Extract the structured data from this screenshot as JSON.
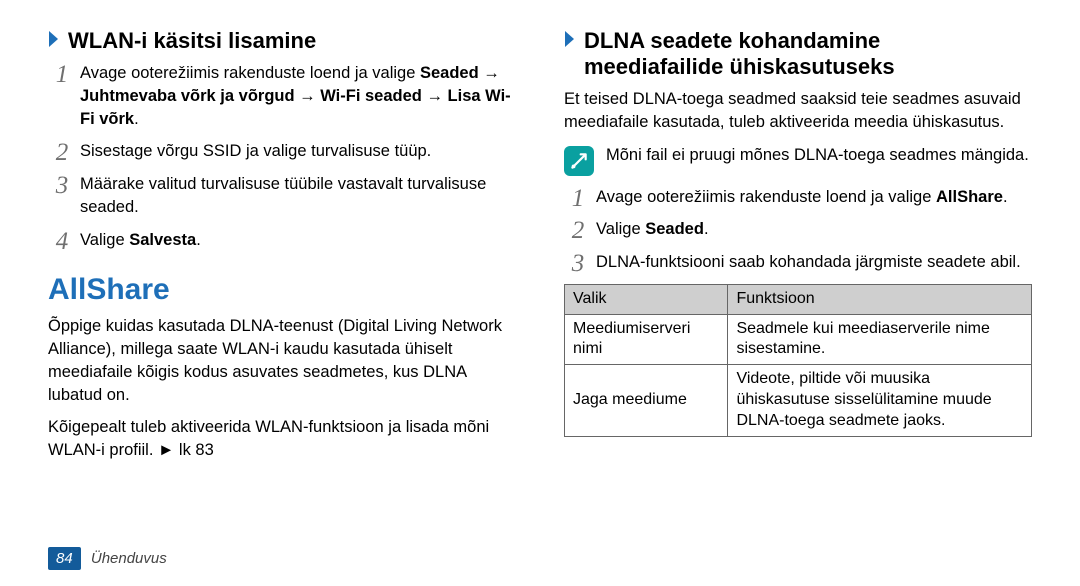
{
  "left": {
    "heading": "WLAN-i käsitsi lisamine",
    "step1_a": "Avage ooterežiimis rakenduste loend ja valige ",
    "step1_b": "Seaded",
    "step1_c": " → ",
    "step1_d": "Juhtmevaba võrk ja võrgud",
    "step1_e": " → ",
    "step1_f": "Wi-Fi seaded",
    "step1_g": " → ",
    "step1_h": "Lisa Wi-Fi võrk",
    "step1_i": ".",
    "step2": "Sisestage võrgu SSID ja valige turvalisuse tüüp.",
    "step3": "Määrake valitud turvalisuse tüübile vastavalt turvalisuse seaded.",
    "step4_a": "Valige ",
    "step4_b": "Salvesta",
    "step4_c": ".",
    "section_title": "AllShare",
    "para1": "Õppige kuidas kasutada DLNA-teenust (Digital Living Network Alliance), millega saate WLAN-i kaudu kasutada ühiselt meediafaile kõigis kodus asuvates seadmetes, kus DLNA lubatud on.",
    "para2": "Kõigepealt tuleb aktiveerida WLAN-funktsioon ja lisada mõni WLAN-i profiil. ► lk 83"
  },
  "right": {
    "heading_line1": "DLNA seadete kohandamine",
    "heading_line2": "meediafailide ühiskasutuseks",
    "intro": "Et teised DLNA-toega seadmed saaksid teie seadmes asuvaid meediafaile kasutada, tuleb aktiveerida meedia ühiskasutus.",
    "note": "Mõni fail ei pruugi mõnes DLNA-toega seadmes mängida.",
    "step1_a": "Avage ooterežiimis rakenduste loend ja valige ",
    "step1_b": "AllShare",
    "step1_c": ".",
    "step2_a": "Valige ",
    "step2_b": "Seaded",
    "step2_c": ".",
    "step3": "DLNA-funktsiooni saab kohandada järgmiste seadete abil.",
    "th_option": "Valik",
    "th_function": "Funktsioon",
    "row1_opt": "Meediumiserveri nimi",
    "row1_fn": "Seadmele kui meediaserverile nime sisestamine.",
    "row2_opt": "Jaga meediume",
    "row2_fn": "Videote, piltide või muusika ühiskasutuse sisselülitamine muude DLNA-toega seadmete jaoks."
  },
  "footer": {
    "page": "84",
    "section": "Ühenduvus"
  }
}
